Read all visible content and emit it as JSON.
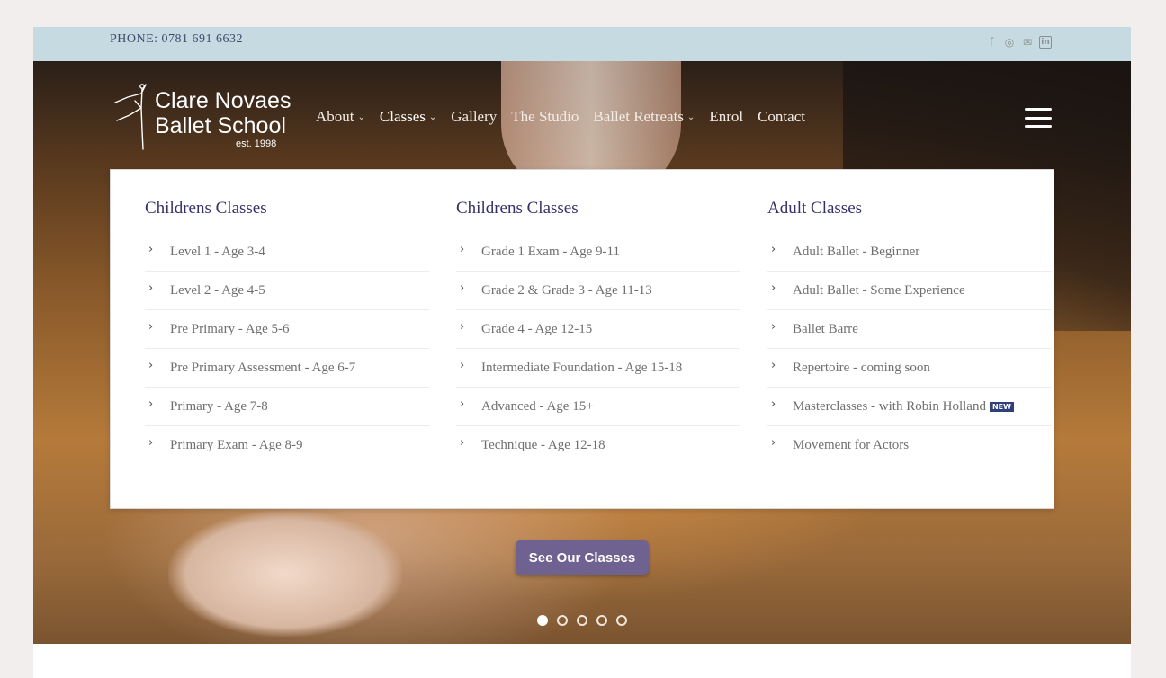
{
  "topbar": {
    "phone": "PHONE: 0781 691 6632",
    "social": [
      {
        "icon": "facebook-icon",
        "glyph": "f"
      },
      {
        "icon": "instagram-icon",
        "glyph": "◎"
      },
      {
        "icon": "email-icon",
        "glyph": "✉"
      },
      {
        "icon": "linkedin-icon",
        "glyph": "in"
      }
    ]
  },
  "logo": {
    "line1": "Clare Novaes",
    "line2": "Ballet School",
    "line3": "est. 1998"
  },
  "nav": [
    {
      "label": "About",
      "has_dropdown": true
    },
    {
      "label": "Classes",
      "has_dropdown": true,
      "active": true
    },
    {
      "label": "Gallery",
      "has_dropdown": false
    },
    {
      "label": "The Studio",
      "has_dropdown": false
    },
    {
      "label": "Ballet Retreats",
      "has_dropdown": true
    },
    {
      "label": "Enrol",
      "has_dropdown": false
    },
    {
      "label": "Contact",
      "has_dropdown": false
    }
  ],
  "mega": {
    "columns": [
      {
        "title": "Childrens Classes",
        "items": [
          {
            "label": "Level 1 - Age 3-4"
          },
          {
            "label": "Level 2 - Age 4-5"
          },
          {
            "label": "Pre Primary - Age 5-6"
          },
          {
            "label": "Pre Primary Assessment - Age 6-7"
          },
          {
            "label": "Primary - Age 7-8"
          },
          {
            "label": "Primary Exam - Age 8-9"
          }
        ]
      },
      {
        "title": "Childrens Classes",
        "items": [
          {
            "label": "Grade 1 Exam - Age 9-11"
          },
          {
            "label": "Grade 2 & Grade 3 - Age 11-13"
          },
          {
            "label": "Grade 4 - Age 12-15"
          },
          {
            "label": "Intermediate Foundation - Age 15-18"
          },
          {
            "label": "Advanced - Age 15+"
          },
          {
            "label": "Technique - Age 12-18"
          }
        ]
      },
      {
        "title": "Adult Classes",
        "items": [
          {
            "label": "Adult Ballet - Beginner"
          },
          {
            "label": "Adult Ballet - Some Experience"
          },
          {
            "label": "Ballet Barre"
          },
          {
            "label": "Repertoire - coming soon"
          },
          {
            "label": "Masterclasses - with Robin Holland",
            "badge": "NEW"
          },
          {
            "label": "Movement for Actors"
          }
        ]
      }
    ]
  },
  "cta": {
    "label": "See Our Classes"
  },
  "slider": {
    "count": 5,
    "active": 1
  },
  "colors": {
    "topbar": "#c5dbe1",
    "accent": "#6f6190",
    "heading": "#35306a"
  }
}
